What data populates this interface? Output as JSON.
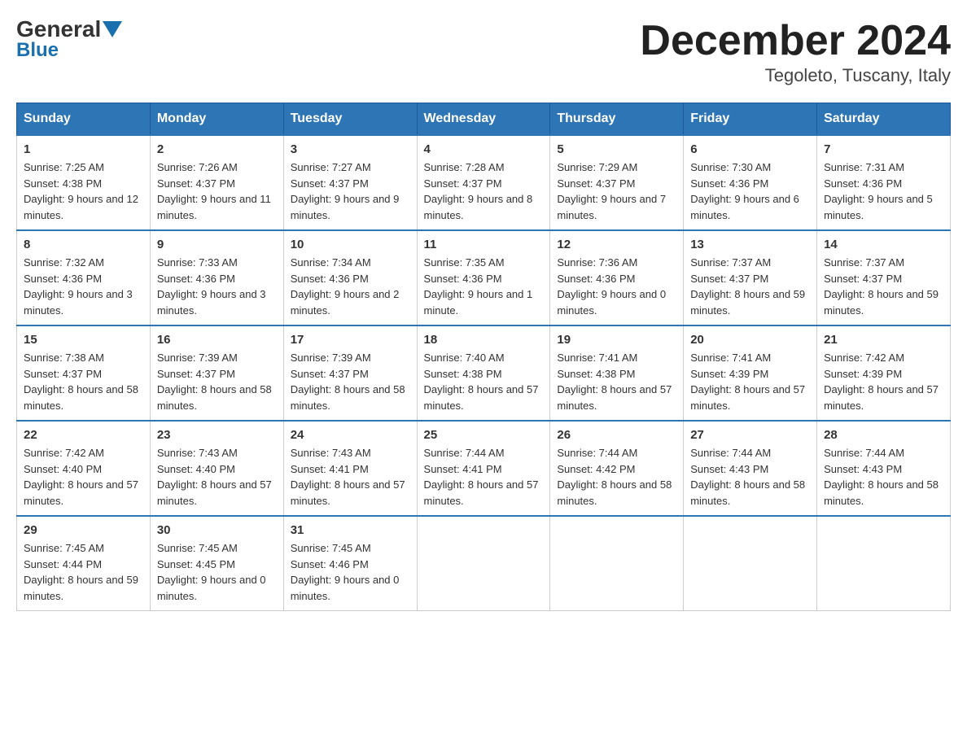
{
  "header": {
    "logo": {
      "general": "General",
      "blue": "Blue"
    },
    "title": "December 2024",
    "location": "Tegoleto, Tuscany, Italy"
  },
  "weekdays": [
    "Sunday",
    "Monday",
    "Tuesday",
    "Wednesday",
    "Thursday",
    "Friday",
    "Saturday"
  ],
  "weeks": [
    [
      {
        "day": "1",
        "sunrise": "7:25 AM",
        "sunset": "4:38 PM",
        "daylight": "9 hours and 12 minutes."
      },
      {
        "day": "2",
        "sunrise": "7:26 AM",
        "sunset": "4:37 PM",
        "daylight": "9 hours and 11 minutes."
      },
      {
        "day": "3",
        "sunrise": "7:27 AM",
        "sunset": "4:37 PM",
        "daylight": "9 hours and 9 minutes."
      },
      {
        "day": "4",
        "sunrise": "7:28 AM",
        "sunset": "4:37 PM",
        "daylight": "9 hours and 8 minutes."
      },
      {
        "day": "5",
        "sunrise": "7:29 AM",
        "sunset": "4:37 PM",
        "daylight": "9 hours and 7 minutes."
      },
      {
        "day": "6",
        "sunrise": "7:30 AM",
        "sunset": "4:36 PM",
        "daylight": "9 hours and 6 minutes."
      },
      {
        "day": "7",
        "sunrise": "7:31 AM",
        "sunset": "4:36 PM",
        "daylight": "9 hours and 5 minutes."
      }
    ],
    [
      {
        "day": "8",
        "sunrise": "7:32 AM",
        "sunset": "4:36 PM",
        "daylight": "9 hours and 3 minutes."
      },
      {
        "day": "9",
        "sunrise": "7:33 AM",
        "sunset": "4:36 PM",
        "daylight": "9 hours and 3 minutes."
      },
      {
        "day": "10",
        "sunrise": "7:34 AM",
        "sunset": "4:36 PM",
        "daylight": "9 hours and 2 minutes."
      },
      {
        "day": "11",
        "sunrise": "7:35 AM",
        "sunset": "4:36 PM",
        "daylight": "9 hours and 1 minute."
      },
      {
        "day": "12",
        "sunrise": "7:36 AM",
        "sunset": "4:36 PM",
        "daylight": "9 hours and 0 minutes."
      },
      {
        "day": "13",
        "sunrise": "7:37 AM",
        "sunset": "4:37 PM",
        "daylight": "8 hours and 59 minutes."
      },
      {
        "day": "14",
        "sunrise": "7:37 AM",
        "sunset": "4:37 PM",
        "daylight": "8 hours and 59 minutes."
      }
    ],
    [
      {
        "day": "15",
        "sunrise": "7:38 AM",
        "sunset": "4:37 PM",
        "daylight": "8 hours and 58 minutes."
      },
      {
        "day": "16",
        "sunrise": "7:39 AM",
        "sunset": "4:37 PM",
        "daylight": "8 hours and 58 minutes."
      },
      {
        "day": "17",
        "sunrise": "7:39 AM",
        "sunset": "4:37 PM",
        "daylight": "8 hours and 58 minutes."
      },
      {
        "day": "18",
        "sunrise": "7:40 AM",
        "sunset": "4:38 PM",
        "daylight": "8 hours and 57 minutes."
      },
      {
        "day": "19",
        "sunrise": "7:41 AM",
        "sunset": "4:38 PM",
        "daylight": "8 hours and 57 minutes."
      },
      {
        "day": "20",
        "sunrise": "7:41 AM",
        "sunset": "4:39 PM",
        "daylight": "8 hours and 57 minutes."
      },
      {
        "day": "21",
        "sunrise": "7:42 AM",
        "sunset": "4:39 PM",
        "daylight": "8 hours and 57 minutes."
      }
    ],
    [
      {
        "day": "22",
        "sunrise": "7:42 AM",
        "sunset": "4:40 PM",
        "daylight": "8 hours and 57 minutes."
      },
      {
        "day": "23",
        "sunrise": "7:43 AM",
        "sunset": "4:40 PM",
        "daylight": "8 hours and 57 minutes."
      },
      {
        "day": "24",
        "sunrise": "7:43 AM",
        "sunset": "4:41 PM",
        "daylight": "8 hours and 57 minutes."
      },
      {
        "day": "25",
        "sunrise": "7:44 AM",
        "sunset": "4:41 PM",
        "daylight": "8 hours and 57 minutes."
      },
      {
        "day": "26",
        "sunrise": "7:44 AM",
        "sunset": "4:42 PM",
        "daylight": "8 hours and 58 minutes."
      },
      {
        "day": "27",
        "sunrise": "7:44 AM",
        "sunset": "4:43 PM",
        "daylight": "8 hours and 58 minutes."
      },
      {
        "day": "28",
        "sunrise": "7:44 AM",
        "sunset": "4:43 PM",
        "daylight": "8 hours and 58 minutes."
      }
    ],
    [
      {
        "day": "29",
        "sunrise": "7:45 AM",
        "sunset": "4:44 PM",
        "daylight": "8 hours and 59 minutes."
      },
      {
        "day": "30",
        "sunrise": "7:45 AM",
        "sunset": "4:45 PM",
        "daylight": "9 hours and 0 minutes."
      },
      {
        "day": "31",
        "sunrise": "7:45 AM",
        "sunset": "4:46 PM",
        "daylight": "9 hours and 0 minutes."
      },
      null,
      null,
      null,
      null
    ]
  ],
  "labels": {
    "sunrise": "Sunrise:",
    "sunset": "Sunset:",
    "daylight": "Daylight:"
  }
}
